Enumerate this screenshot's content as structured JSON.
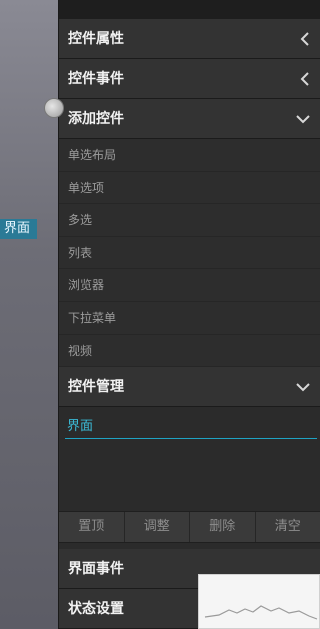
{
  "canvas": {
    "screen_tag": "界面"
  },
  "panel": {
    "sections": {
      "properties": "控件属性",
      "events": "控件事件",
      "add": "添加控件",
      "manage": "控件管理",
      "screen_events": "界面事件",
      "state": "状态设置"
    },
    "add_items": [
      "单选布局",
      "单选项",
      "多选",
      "列表",
      "浏览器",
      "下拉菜单",
      "视频"
    ],
    "manage_input_value": "界面",
    "buttons": [
      "置顶",
      "调整",
      "删除",
      "清空"
    ]
  }
}
